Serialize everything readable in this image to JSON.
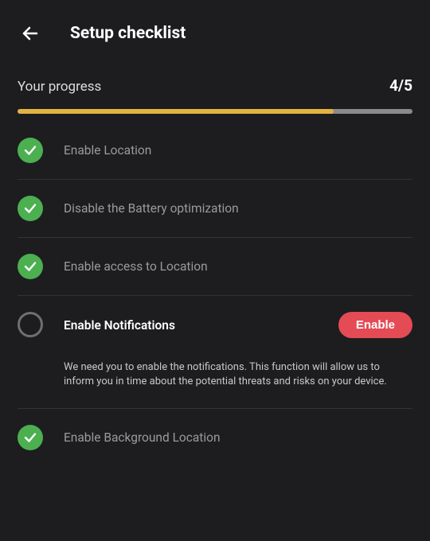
{
  "header": {
    "title": "Setup checklist"
  },
  "progress": {
    "label": "Your progress",
    "count": "4/5",
    "percent": 80
  },
  "items": [
    {
      "label": "Enable Location",
      "done": true
    },
    {
      "label": "Disable the Battery optimization",
      "done": true
    },
    {
      "label": "Enable access to Location",
      "done": true
    },
    {
      "label": "Enable Notifications",
      "done": false,
      "button": "Enable",
      "description": "We need you to enable the notifications. This function will allow us to inform you in time about the potential threats and risks on your device."
    },
    {
      "label": "Enable Background Location",
      "done": true
    }
  ]
}
